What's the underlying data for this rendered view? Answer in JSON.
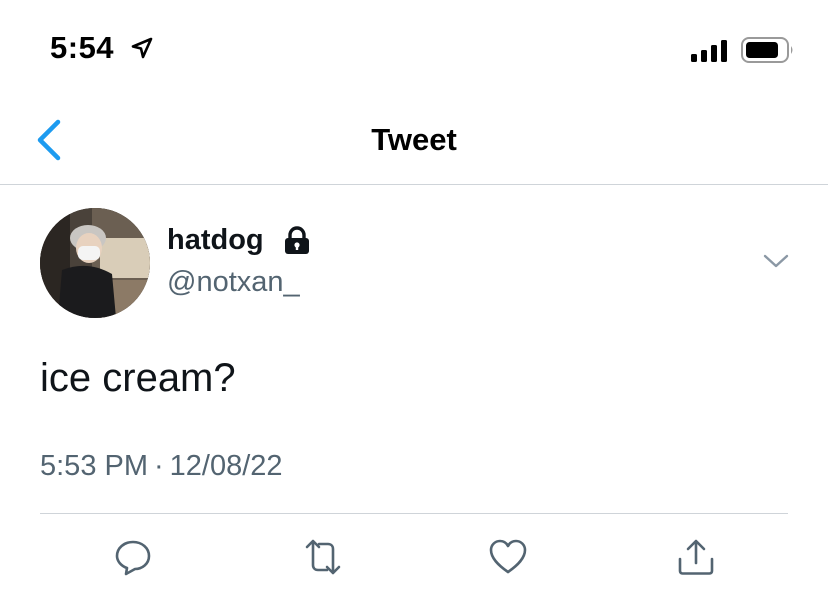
{
  "status_bar": {
    "time": "5:54",
    "location_icon": "location-arrow-icon",
    "signal_icon": "cellular-signal-icon",
    "battery_icon": "battery-icon"
  },
  "header": {
    "title": "Tweet",
    "back_icon": "chevron-left-icon",
    "accent_color": "#1d9bf0"
  },
  "tweet": {
    "display_name": "hatdog",
    "protected_icon": "lock-icon",
    "handle": "@notxan_",
    "text": "ice cream?",
    "time": "5:53 PM",
    "separator": "·",
    "date": "12/08/22"
  },
  "actions": [
    {
      "name": "reply",
      "icon": "reply-icon"
    },
    {
      "name": "retweet",
      "icon": "retweet-icon"
    },
    {
      "name": "like",
      "icon": "heart-icon"
    },
    {
      "name": "share",
      "icon": "share-icon"
    }
  ],
  "colors": {
    "text_primary": "#0f1419",
    "text_secondary": "#536471",
    "divider": "#cfd4d9",
    "icon": "#536471"
  }
}
